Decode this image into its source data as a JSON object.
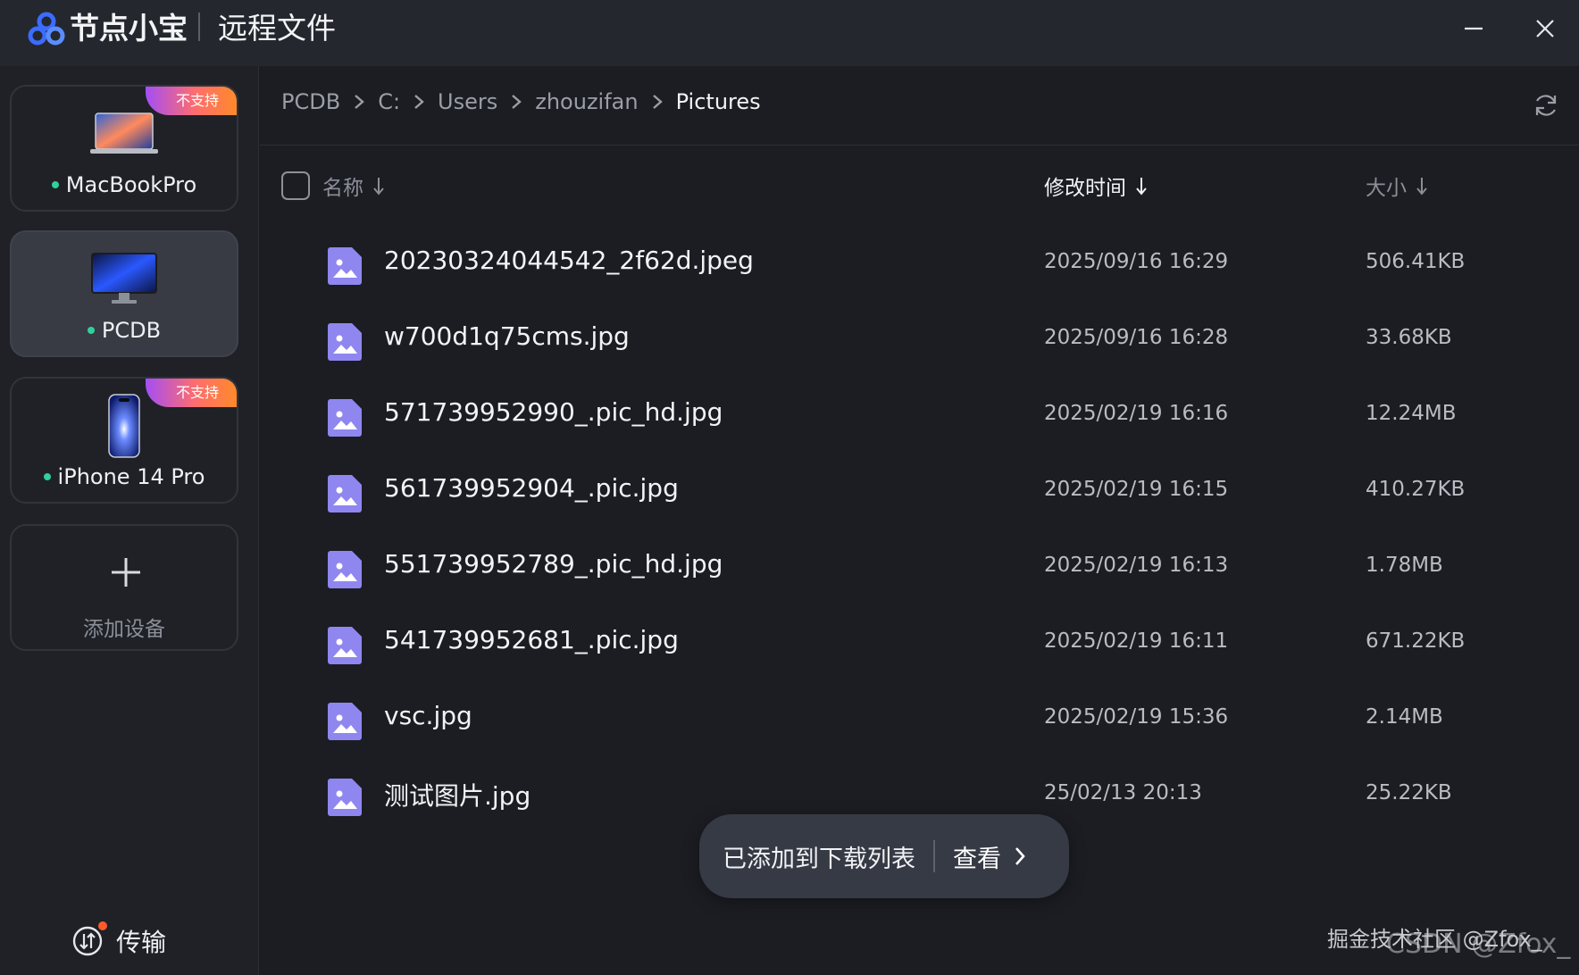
{
  "titlebar": {
    "app_name": "节点小宝",
    "window_title": "远程文件"
  },
  "sidebar": {
    "devices": [
      {
        "name": "MacBookPro",
        "badge": "不支持",
        "online": true,
        "active": false
      },
      {
        "name": "PCDB",
        "badge": "",
        "online": true,
        "active": true
      },
      {
        "name": "iPhone 14 Pro",
        "badge": "不支持",
        "online": true,
        "active": false
      }
    ],
    "add_device_label": "添加设备",
    "transfer_label": "传输"
  },
  "breadcrumb": [
    "PCDB",
    "C:",
    "Users",
    "zhouzifan",
    "Pictures"
  ],
  "columns": {
    "name": "名称",
    "modified": "修改时间",
    "size": "大小"
  },
  "files": [
    {
      "name": "20230324044542_2f62d.jpeg",
      "modified": "2025/09/16 16:29",
      "size": "506.41KB"
    },
    {
      "name": "w700d1q75cms.jpg",
      "modified": "2025/09/16 16:28",
      "size": "33.68KB"
    },
    {
      "name": "571739952990_.pic_hd.jpg",
      "modified": "2025/02/19 16:16",
      "size": "12.24MB"
    },
    {
      "name": "561739952904_.pic.jpg",
      "modified": "2025/02/19 16:15",
      "size": "410.27KB"
    },
    {
      "name": "551739952789_.pic_hd.jpg",
      "modified": "2025/02/19 16:13",
      "size": "1.78MB"
    },
    {
      "name": "541739952681_.pic.jpg",
      "modified": "2025/02/19 16:11",
      "size": "671.22KB"
    },
    {
      "name": "vsc.jpg",
      "modified": "2025/02/19 15:36",
      "size": "2.14MB"
    },
    {
      "name": "测试图片.jpg",
      "modified": "25/02/13 20:13",
      "size": "25.22KB"
    }
  ],
  "toast": {
    "message": "已添加到下载列表",
    "action": "查看"
  },
  "watermark": "掘金技术社区 @Zfox_",
  "watermark2": "CSDN @Zfox_",
  "colors": {
    "accent": "#3b6cff",
    "online": "#2ed19a",
    "badge_gradient_start": "#a44ef5",
    "badge_gradient_end": "#ff8a2a",
    "file_icon": "#8f86f0",
    "notification_dot": "#ff5a2c"
  },
  "icons": {
    "logo": "node-logo-icon",
    "minimize": "minimize-icon",
    "close": "close-icon",
    "refresh": "refresh-icon",
    "file": "image-file-icon",
    "transfer": "transfer-icon",
    "add": "plus-icon",
    "sort": "sort-down-icon",
    "chevron": "chevron-right-icon"
  }
}
